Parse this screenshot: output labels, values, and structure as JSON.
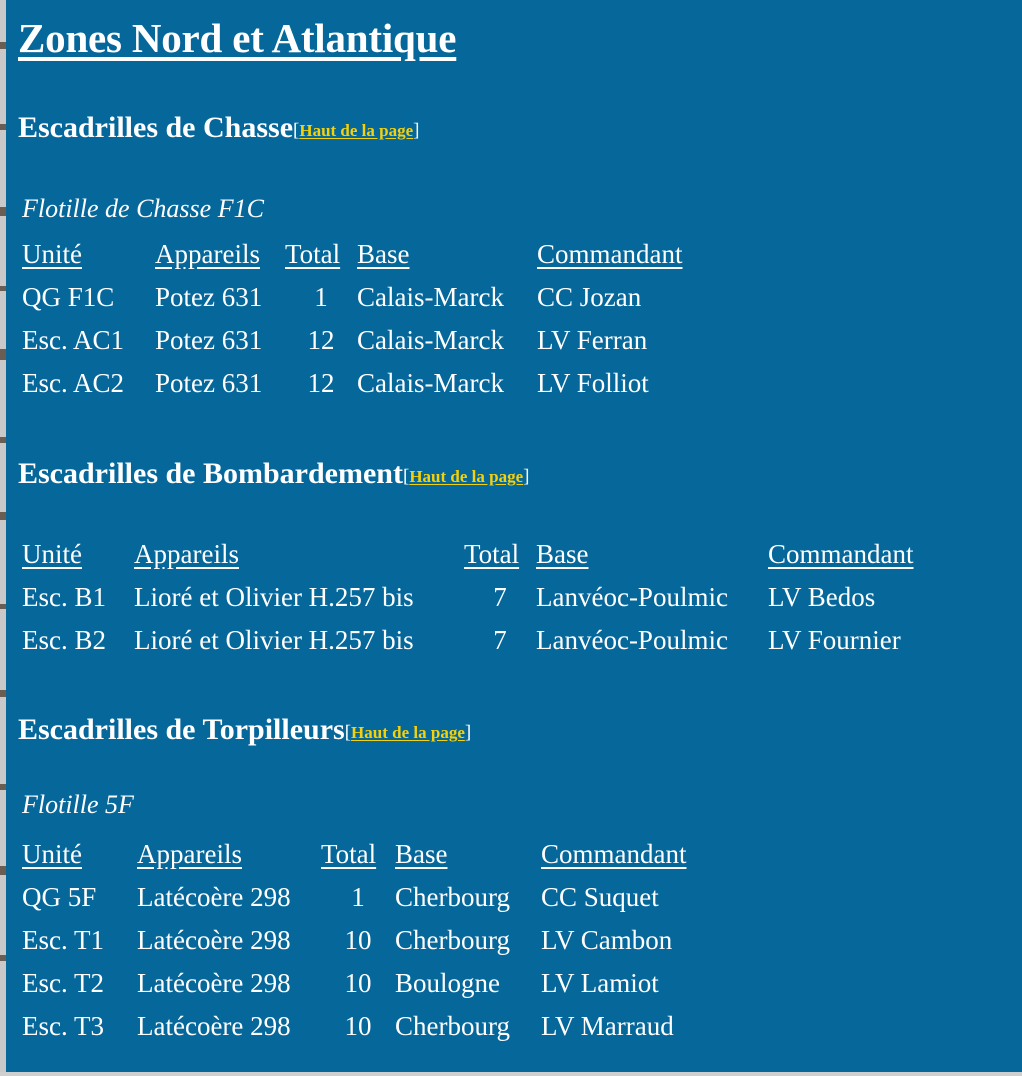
{
  "page": {
    "title": "Zones Nord et Atlantique",
    "background_color": "#06679b",
    "text_color": "#ffffff",
    "link_color": "#f5d10a"
  },
  "sections": [
    {
      "heading": "Escadrilles de Chasse",
      "top_link": "Haut de la page",
      "bracket_open": "[",
      "bracket_close": "]",
      "subheading": "Flotille de Chasse F1C",
      "columns": [
        "Unité",
        "Appareils",
        "Total",
        "Base",
        "Commandant"
      ],
      "rows": [
        [
          "QG F1C",
          "Potez 631",
          "1",
          "Calais-Marck",
          "CC Jozan"
        ],
        [
          "Esc. AC1",
          "Potez 631",
          "12",
          "Calais-Marck",
          "LV Ferran"
        ],
        [
          "Esc. AC2",
          "Potez 631",
          "12",
          "Calais-Marck",
          "LV Folliot"
        ]
      ]
    },
    {
      "heading": "Escadrilles de Bombardement",
      "top_link": "Haut de la page",
      "bracket_open": "[",
      "bracket_close": "]",
      "subheading": "",
      "columns": [
        "Unité",
        "Appareils",
        "Total",
        "Base",
        "Commandant"
      ],
      "rows": [
        [
          "Esc. B1",
          "Lioré et Olivier H.257 bis",
          "7",
          "Lanvéoc-Poulmic",
          "LV Bedos"
        ],
        [
          "Esc. B2",
          "Lioré et Olivier H.257 bis",
          "7",
          "Lanvéoc-Poulmic",
          "LV Fournier"
        ]
      ]
    },
    {
      "heading": "Escadrilles de Torpilleurs",
      "top_link": "Haut de la page",
      "bracket_open": "[",
      "bracket_close": "]",
      "subheading": "Flotille 5F",
      "columns": [
        "Unité",
        "Appareils",
        "Total",
        "Base",
        "Commandant"
      ],
      "rows": [
        [
          "QG 5F",
          "Latécoère 298",
          "1",
          "Cherbourg",
          "CC Suquet"
        ],
        [
          "Esc. T1",
          "Latécoère 298",
          "10",
          "Cherbourg",
          "LV Cambon"
        ],
        [
          "Esc. T2",
          "Latécoère 298",
          "10",
          "Boulogne",
          "LV Lamiot"
        ],
        [
          "Esc. T3",
          "Latécoère 298",
          "10",
          "Cherbourg",
          "LV Marraud"
        ]
      ]
    }
  ]
}
